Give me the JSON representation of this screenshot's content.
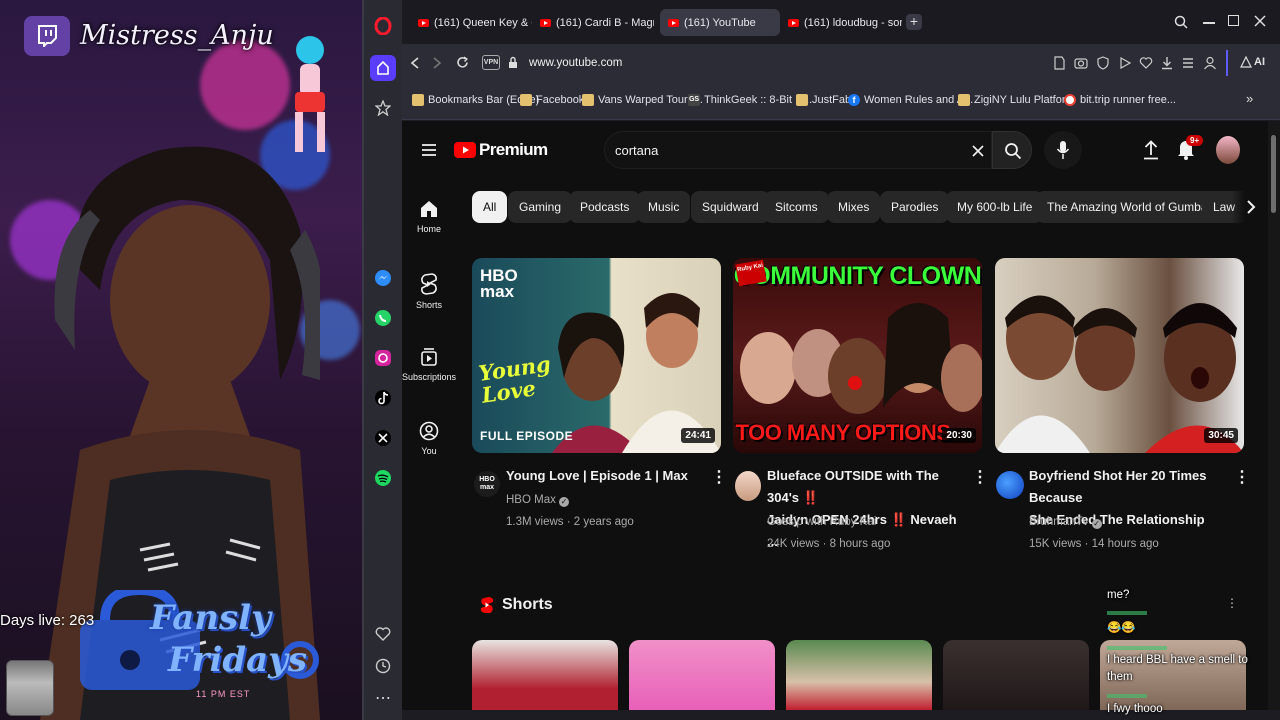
{
  "stream": {
    "streamer_name": "Mistress_Anju",
    "days_live": "Days live: 263",
    "promo_title_1": "Fansly",
    "promo_title_2": "Fridays",
    "promo_time": "11 PM EST"
  },
  "browser": {
    "tabs": [
      {
        "label": "(161) Queen Key & GloRill",
        "active": false
      },
      {
        "label": "(161) Cardi B - Magnet (Ly",
        "active": false
      },
      {
        "label": "(161) YouTube",
        "active": true
      },
      {
        "label": "(161) ldoudbug - some du",
        "active": false
      }
    ],
    "vpn_label": "VPN",
    "url": "www.youtube.com",
    "ai_label": "AI",
    "bookmarks": [
      {
        "label": "Bookmarks Bar (Edge)",
        "icon_color": "#e3c16f"
      },
      {
        "label": "Facebook",
        "icon_color": "#e3c16f"
      },
      {
        "label": "Vans Warped Tour /...",
        "icon_color": "#e3c16f"
      },
      {
        "label": "ThinkGeek :: 8-Bit D...",
        "icon_color": "#444444",
        "icon_text": "GS"
      },
      {
        "label": "JustFab",
        "icon_color": "#e3c16f"
      },
      {
        "label": "Women Rules and A...",
        "icon_color": "#1877f2"
      },
      {
        "label": "ZigiNY Lulu Platfor...",
        "icon_color": "#e3c16f"
      },
      {
        "label": "bit.trip runner free...",
        "icon_color": "#ffffff"
      }
    ]
  },
  "youtube": {
    "brand": "Premium",
    "search_value": "cortana",
    "notification_count": "9+",
    "nav": [
      {
        "label": "Home",
        "icon": "home-icon"
      },
      {
        "label": "Shorts",
        "icon": "shorts-icon"
      },
      {
        "label": "Subscriptions",
        "icon": "subscriptions-icon"
      },
      {
        "label": "You",
        "icon": "you-icon"
      }
    ],
    "chips": [
      "All",
      "Gaming",
      "Podcasts",
      "Music",
      "Squidward",
      "Sitcoms",
      "Mixes",
      "Parodies",
      "My 600-lb Life",
      "The Amazing World of Gumball",
      "Law"
    ],
    "videos": [
      {
        "title_line1": "Young Love | Episode 1 | Max",
        "title_line2": "",
        "channel": "HBO Max",
        "verified": true,
        "meta": "1.3M views · 2 years ago",
        "duration": "24:41",
        "thumb_text_1": "HBO max",
        "thumb_text_2": "Young Love",
        "thumb_text_3": "FULL EPISODE",
        "avatar_text": "HBO max"
      },
      {
        "title_line1": "Blueface OUTSIDE with The 304's ‼️",
        "title_line2": "Jaidyn OPEN 24hrs ‼️ Nevaeh ...",
        "channel": "Gossip with Ruby Kai",
        "verified": false,
        "meta": "24K views · 8 hours ago",
        "duration": "20:30",
        "thumb_text_1": "COMMUNITY CLOWN",
        "thumb_text_2": "TOO MANY OPTIONS",
        "thumb_text_3": "Ruby Kai"
      },
      {
        "title_line1": "Boyfriend Shot Her 20 Times Because",
        "title_line2": "She Ended The Relationship",
        "channel": "BruhmanTv",
        "verified": true,
        "meta": "15K views · 14 hours ago",
        "duration": "30:45"
      }
    ],
    "shorts_heading": "Shorts"
  },
  "chat": [
    {
      "text": "me?"
    },
    {
      "text": "😂😂"
    },
    {
      "text": "I heard BBL have a smell to"
    },
    {
      "text": "them"
    },
    {
      "text": "I fwy thooo"
    }
  ],
  "colors": {
    "yt_red": "#ff0000",
    "twitch_purple": "#6441a5",
    "chip_bg": "#272727",
    "page_bg": "#0f0f0f"
  }
}
